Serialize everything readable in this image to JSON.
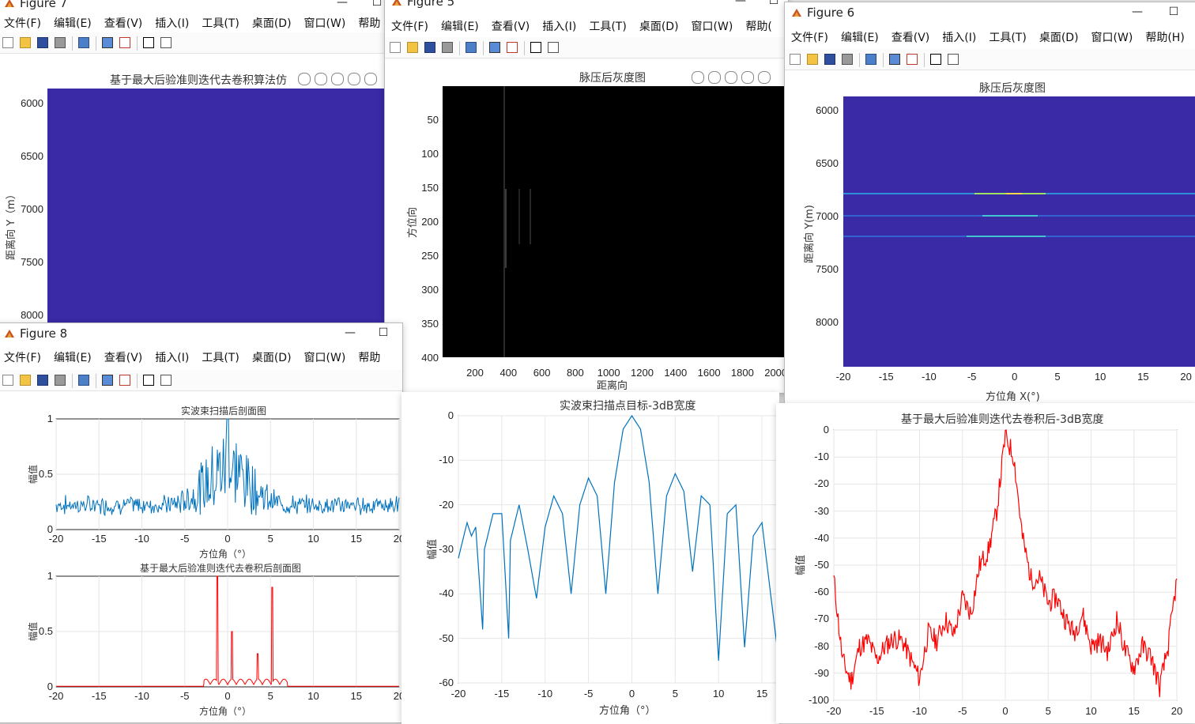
{
  "figure7": {
    "title": "Figure 7",
    "plot_title": "基于最大后验准则迭代去卷积算法仿",
    "ylabel": "距离向 Y（m）",
    "yticks": [
      "6000",
      "6500",
      "7000",
      "7500",
      "8000"
    ],
    "image_color": "#3a2aa6"
  },
  "figure5": {
    "title": "Figure 5",
    "plot_title": "脉压后灰度图",
    "xlabel": "距离向",
    "ylabel": "方位向",
    "xticks": [
      "200",
      "400",
      "600",
      "800",
      "1000",
      "1200",
      "1400",
      "1600",
      "1800",
      "2000"
    ],
    "yticks": [
      "50",
      "100",
      "150",
      "200",
      "250",
      "300",
      "350",
      "400"
    ]
  },
  "figure6": {
    "title": "Figure 6",
    "plot_title": "脉压后灰度图",
    "xlabel": "方位角 X(°)",
    "ylabel": "距离向 Y(m)",
    "xticks": [
      "-20",
      "-15",
      "-10",
      "-5",
      "0",
      "5",
      "10",
      "15",
      "20"
    ],
    "yticks": [
      "6000",
      "6500",
      "7000",
      "7500",
      "8000"
    ],
    "image_color": "#3a2aa6"
  },
  "figure8": {
    "title": "Figure 8",
    "top_title": "实波束扫描后剖面图",
    "bottom_title": "基于最大后验准则迭代去卷积后剖面图",
    "xlabel": "方位角（°）",
    "ylabel": "幅值",
    "xticks": [
      "-20",
      "-15",
      "-10",
      "-5",
      "0",
      "5",
      "10",
      "15",
      "20"
    ],
    "yticks": [
      "0",
      "0.5",
      "1"
    ]
  },
  "mid_plot": {
    "title": "实波束扫描点目标-3dB宽度",
    "xlabel": "方位角（°）",
    "ylabel": "幅值",
    "xticks": [
      "-20",
      "-15",
      "-10",
      "-5",
      "0",
      "5",
      "10",
      "15"
    ],
    "yticks": [
      "0",
      "-10",
      "-20",
      "-30",
      "-40",
      "-50",
      "-60"
    ]
  },
  "right_plot": {
    "title": "基于最大后验准则迭代去卷积后-3dB宽度",
    "ylabel": "幅值",
    "xticks": [
      "-20",
      "-15",
      "-10",
      "-5",
      "0",
      "5",
      "10",
      "15",
      "20"
    ],
    "yticks": [
      "0",
      "-10",
      "-20",
      "-30",
      "-40",
      "-50",
      "-60",
      "-70",
      "-80",
      "-90",
      "-100"
    ]
  },
  "menus_full": [
    "文件(F)",
    "编辑(E)",
    "查看(V)",
    "插入(I)",
    "工具(T)",
    "桌面(D)",
    "窗口(W)",
    "帮助(H)"
  ],
  "menus_fig7": [
    "文件(F)",
    "编辑(E)",
    "查看(V)",
    "插入(I)",
    "工具(T)",
    "桌面(D)",
    "窗口(W)",
    "帮助"
  ],
  "menus_fig5": [
    "文件(F)",
    "编辑(E)",
    "查看(V)",
    "插入(I)",
    "工具(T)",
    "桌面(D)",
    "窗口(W)",
    "帮助("
  ],
  "menus_fig8": [
    "文件(F)",
    "编辑(E)",
    "查看(V)",
    "插入(I)",
    "工具(T)",
    "桌面(D)",
    "窗口(W)",
    "帮助"
  ],
  "menus_fig6": [
    "文件(F)",
    "编辑(E)",
    "查看(V)",
    "插入(I)",
    "工具(T)",
    "桌面(D)",
    "窗口(W)",
    "帮助(H)"
  ],
  "colors": {
    "blue_line": "#0072BD",
    "red_line": "#FF0000",
    "parula_bg": "#3a2aa6"
  },
  "chart_data": [
    {
      "type": "heatmap",
      "title": "基于最大后验准则迭代去卷积算法仿",
      "ylabel": "距离向 Y（m）",
      "ylim": [
        5900,
        8050
      ]
    },
    {
      "type": "heatmap",
      "title": "脉压后灰度图",
      "xlabel": "距离向",
      "ylabel": "方位向",
      "xlim": [
        0,
        2048
      ],
      "ylim": [
        0,
        400
      ]
    },
    {
      "type": "heatmap",
      "title": "脉压后灰度图",
      "xlabel": "方位角 X(°)",
      "ylabel": "距离向 Y(m)",
      "xlim": [
        -20,
        20
      ],
      "ylim": [
        5900,
        8450
      ],
      "bright_lines_y": [
        6800,
        7000,
        7200
      ]
    },
    {
      "type": "line",
      "title": "实波束扫描后剖面图",
      "xlabel": "方位角（°）",
      "ylabel": "幅值",
      "xlim": [
        -20,
        20
      ],
      "ylim": [
        0,
        1
      ],
      "peak_x": 0,
      "peak_y": 1
    },
    {
      "type": "line",
      "title": "基于最大后验准则迭代去卷积后剖面图",
      "xlabel": "方位角（°）",
      "ylabel": "幅值",
      "xlim": [
        -20,
        20
      ],
      "ylim": [
        0,
        1
      ],
      "spikes": [
        {
          "x": -1.2,
          "y": 1.0
        },
        {
          "x": 0.5,
          "y": 0.5
        },
        {
          "x": 3.5,
          "y": 0.3
        },
        {
          "x": 5.2,
          "y": 0.9
        }
      ]
    },
    {
      "type": "line",
      "title": "实波束扫描点目标-3dB宽度",
      "xlabel": "方位角（°）",
      "ylabel": "幅值",
      "xlim": [
        -20,
        17
      ],
      "ylim": [
        -60,
        0
      ],
      "x": [
        -20,
        -19,
        -18.5,
        -18,
        -17.2,
        -17,
        -16,
        -15,
        -14.2,
        -14,
        -13,
        -12,
        -11,
        -10,
        -9,
        -8,
        -7,
        -6,
        -5,
        -4,
        -3,
        -2,
        -1,
        0,
        1,
        2,
        3,
        4,
        5,
        6,
        7,
        8,
        9,
        10,
        11,
        12,
        13,
        14,
        15,
        16,
        17
      ],
      "y": [
        -32,
        -24,
        -27,
        -25,
        -48,
        -30,
        -22,
        -22,
        -50,
        -28,
        -20,
        -30,
        -41,
        -25,
        -18,
        -22,
        -40,
        -20,
        -14,
        -18,
        -40,
        -15,
        -3,
        0,
        -3,
        -15,
        -40,
        -18,
        -13,
        -17,
        -35,
        -18,
        -20,
        -55,
        -22,
        -20,
        -52,
        -27,
        -24,
        -40,
        -56
      ]
    },
    {
      "type": "line",
      "title": "基于最大后验准则迭代去卷积后-3dB宽度",
      "ylabel": "幅值",
      "xlim": [
        -20,
        20
      ],
      "ylim": [
        -100,
        0
      ],
      "x": [
        -20,
        -19,
        -18,
        -17,
        -16,
        -15,
        -14,
        -13,
        -12,
        -11,
        -10,
        -9,
        -8,
        -7,
        -6,
        -5,
        -4,
        -3,
        -2,
        -1,
        0,
        1,
        2,
        3,
        4,
        5,
        6,
        7,
        8,
        9,
        10,
        11,
        12,
        13,
        14,
        15,
        16,
        17,
        18,
        19,
        20
      ],
      "y": [
        -55,
        -85,
        -93,
        -80,
        -78,
        -85,
        -80,
        -77,
        -78,
        -85,
        -92,
        -75,
        -78,
        -70,
        -76,
        -62,
        -68,
        -50,
        -45,
        -30,
        -2,
        -10,
        -40,
        -55,
        -55,
        -64,
        -62,
        -70,
        -75,
        -68,
        -80,
        -78,
        -82,
        -70,
        -82,
        -88,
        -80,
        -84,
        -95,
        -80,
        -55
      ]
    }
  ]
}
